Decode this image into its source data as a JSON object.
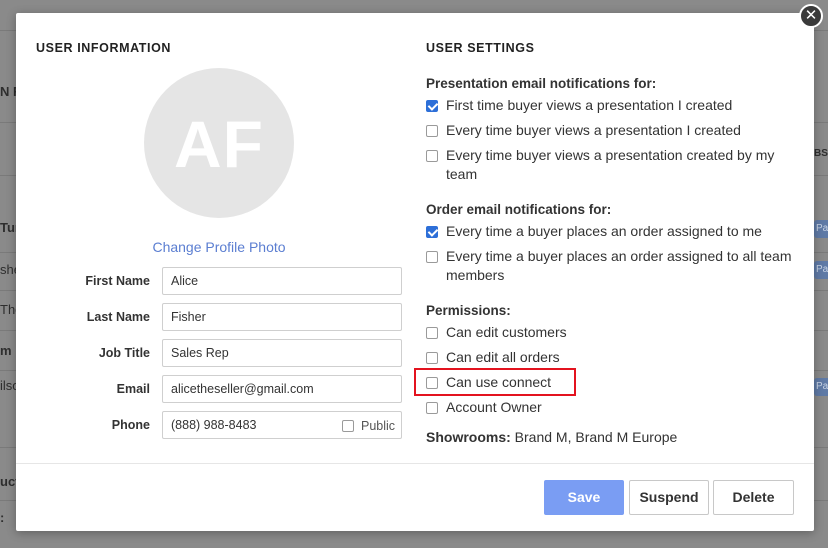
{
  "background": {
    "fragments": [
      "N F",
      "Tur",
      "she",
      "The",
      "m",
      "ilso",
      "uct",
      ":",
      "BS"
    ],
    "pill_text": "Pai"
  },
  "modal": {
    "close_glyph": "✕",
    "user_info": {
      "title": "USER INFORMATION",
      "avatar_initials": "AF",
      "change_photo_label": "Change Profile Photo",
      "fields": {
        "first_name": {
          "label": "First Name",
          "value": "Alice"
        },
        "last_name": {
          "label": "Last Name",
          "value": "Fisher"
        },
        "job_title": {
          "label": "Job Title",
          "value": "Sales Rep"
        },
        "email": {
          "label": "Email",
          "value": "alicetheseller@gmail.com"
        },
        "phone": {
          "label": "Phone",
          "value": "(888) 988-8483",
          "public_label": "Public",
          "public_checked": false
        }
      }
    },
    "user_settings": {
      "title": "USER SETTINGS",
      "presentation": {
        "heading": "Presentation email notifications for:",
        "options": [
          {
            "label": "First time buyer views a presentation I created",
            "checked": true
          },
          {
            "label": "Every time buyer views a presentation I created",
            "checked": false
          },
          {
            "label": "Every time buyer views a presentation created by my team",
            "checked": false
          }
        ]
      },
      "orders": {
        "heading": "Order email notifications for:",
        "options": [
          {
            "label": "Every time a buyer places an order assigned to me",
            "checked": true
          },
          {
            "label": "Every time a buyer places an order assigned to all team members",
            "checked": false
          }
        ]
      },
      "permissions": {
        "heading": "Permissions:",
        "options": [
          {
            "label": "Can edit customers",
            "checked": false
          },
          {
            "label": "Can edit all orders",
            "checked": false
          },
          {
            "label": "Can use connect",
            "checked": false,
            "highlighted": true
          },
          {
            "label": "Account Owner",
            "checked": false
          }
        ]
      },
      "showrooms": {
        "label": "Showrooms:",
        "value": "Brand M, Brand M Europe"
      }
    },
    "footer": {
      "save_label": "Save",
      "suspend_label": "Suspend",
      "delete_label": "Delete"
    },
    "colors": {
      "primary_button": "#7a9df3",
      "checkbox_checked": "#2d6fd8",
      "link": "#5b7ed1",
      "highlight": "#e3131f"
    }
  }
}
